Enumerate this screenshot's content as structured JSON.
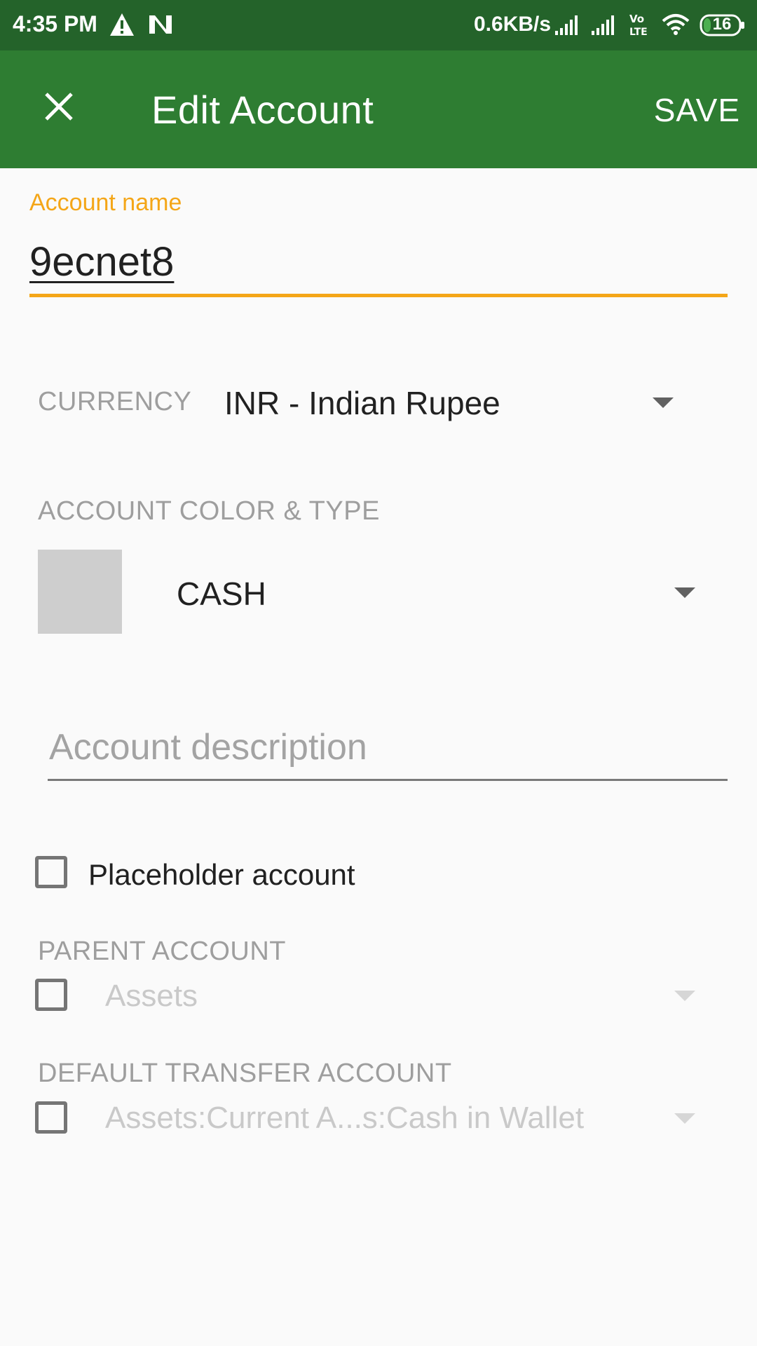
{
  "status_bar": {
    "time": "4:35 PM",
    "net_speed": "0.6KB/s",
    "battery": "16",
    "icons": [
      "warning-icon",
      "n-icon",
      "signal-icon",
      "signal-icon",
      "volte-icon",
      "wifi-icon",
      "battery-icon"
    ]
  },
  "app_bar": {
    "title": "Edit Account",
    "save_label": "SAVE",
    "close_icon": "close-icon",
    "color": "#2e7d32"
  },
  "form": {
    "account_name_label": "Account name",
    "account_name_value": "9ecnet8",
    "currency_label": "CURRENCY",
    "currency_value": "INR - Indian Rupee",
    "color_type_label": "ACCOUNT COLOR & TYPE",
    "account_type_value": "CASH",
    "description_placeholder": "Account description",
    "placeholder_checkbox_label": "Placeholder account",
    "parent_account_label": "PARENT ACCOUNT",
    "parent_account_value": "Assets",
    "default_transfer_label": "DEFAULT TRANSFER ACCOUNT",
    "default_transfer_value": "Assets:Current A...s:Cash in Wallet"
  },
  "colors": {
    "accent": "#f4a618",
    "status_bar": "#24632a",
    "swatch": "#cecece"
  }
}
